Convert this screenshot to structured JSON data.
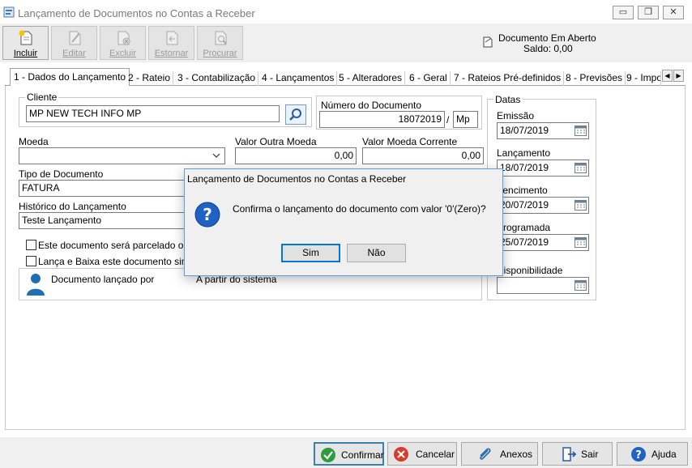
{
  "window": {
    "title": "Lançamento de Documentos no Contas a Receber",
    "controls": {
      "minimize": "▭",
      "restore": "❐",
      "close": "✕"
    }
  },
  "toolbar": {
    "buttons": [
      {
        "label": "Incluir",
        "icon": "new-document-icon",
        "enabled": true
      },
      {
        "label": "Editar",
        "icon": "edit-document-icon",
        "enabled": false
      },
      {
        "label": "Excluir",
        "icon": "delete-document-icon",
        "enabled": false
      },
      {
        "label": "Estornar",
        "icon": "reverse-document-icon",
        "enabled": false
      },
      {
        "label": "Procurar",
        "icon": "search-document-icon",
        "enabled": false
      }
    ],
    "status_title": "Documento Em Aberto",
    "status_saldo": "Saldo: 0,00"
  },
  "tabs": [
    "1 - Dados do Lançamento",
    "2 - Rateio",
    "3 - Contabilização",
    "4 - Lançamentos",
    "5 - Alteradores",
    "6 - Geral",
    "7 - Rateios Pré-definidos",
    "8 - Previsões",
    "9 - Impo"
  ],
  "form": {
    "cliente_label": "Cliente",
    "cliente_value": "MP NEW TECH INFO MP",
    "numero_label": "Número do Documento",
    "numero_value": "18072019",
    "numero_sep": "/",
    "numero_suffix": "Mp",
    "moeda_label": "Moeda",
    "moeda_value": "",
    "valor_outra_label": "Valor Outra Moeda",
    "valor_outra_value": "0,00",
    "valor_corrente_label": "Valor Moeda Corrente",
    "valor_corrente_value": "0,00",
    "tipo_label": "Tipo de Documento",
    "tipo_value": "FATURA",
    "historico_label": "Histórico do Lançamento",
    "historico_value": "Teste Lançamento",
    "check1_label": "Este documento será parcelado ou",
    "check2_label": "Lança e Baixa este documento simu",
    "lancado_por_label": "Documento lançado por",
    "lancado_por_value": "A partir do sistema"
  },
  "datas": {
    "group_label": "Datas",
    "emissao_label": "Emissão",
    "emissao_value": "18/07/2019",
    "lancamento_label": "Lançamento",
    "lancamento_value": "18/07/2019",
    "vencimento_label": "Vencimento",
    "vencimento_value": "20/07/2019",
    "programada_label": "Programada",
    "programada_value": "25/07/2019",
    "disponibilidade_label": "Disponibilidade",
    "disponibilidade_value": ""
  },
  "dialog": {
    "title": "Lançamento de Documentos no Contas a Receber",
    "message": "Confirma o lançamento do documento com valor '0'(Zero)?",
    "yes": "Sim",
    "no": "Não"
  },
  "bottom": {
    "confirmar": "Confirmar",
    "cancelar": "Cancelar",
    "anexos": "Anexos",
    "sair": "Sair",
    "ajuda": "Ajuda"
  }
}
